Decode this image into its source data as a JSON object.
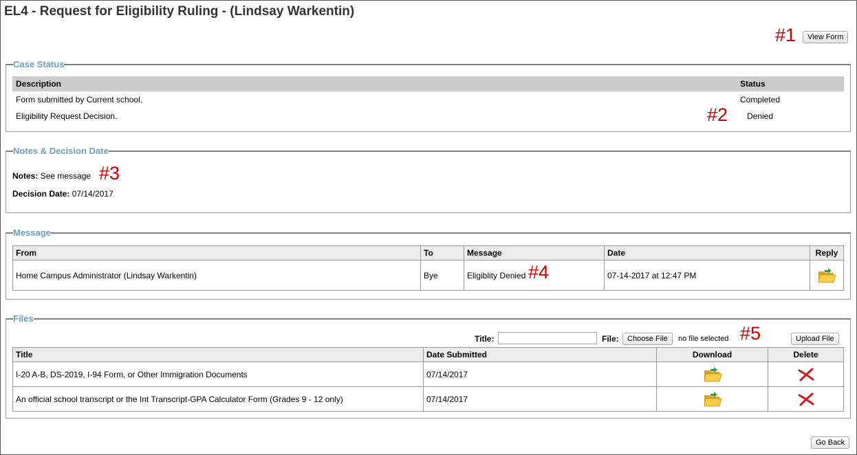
{
  "page": {
    "title": "EL4 - Request for Eligibility Ruling - (Lindsay Warkentin)"
  },
  "toolbar": {
    "view_form_label": "View Form",
    "go_back_label": "Go Back"
  },
  "annotations": [
    "#1",
    "#2",
    "#3",
    "#4",
    "#5"
  ],
  "case_status": {
    "legend": "Case Status",
    "headers": {
      "description": "Description",
      "status": "Status"
    },
    "rows": [
      {
        "description": "Form submitted by Current school.",
        "status": "Completed"
      },
      {
        "description": "Eligibility Request Decision.",
        "status": "Denied"
      }
    ]
  },
  "notes": {
    "legend": "Notes & Decision Date",
    "notes_label": "Notes:",
    "notes_value": "See message",
    "decision_label": "Decision Date:",
    "decision_value": "07/14/2017"
  },
  "message": {
    "legend": "Message",
    "headers": {
      "from": "From",
      "to": "To",
      "message": "Message",
      "date": "Date",
      "reply": "Reply"
    },
    "rows": [
      {
        "from": "Home Campus Administrator (Lindsay Warkentin)",
        "to": "Bye",
        "message": "Eligiblity Denied",
        "date": "07-14-2017 at 12:47 PM",
        "reply_icon": "folder-icon"
      }
    ]
  },
  "files": {
    "legend": "Files",
    "title_label": "Title:",
    "title_value": "",
    "file_label": "File:",
    "choose_file_label": "Choose File",
    "no_file_text": "no file selected",
    "upload_label": "Upload File",
    "headers": {
      "title": "Title",
      "date": "Date Submitted",
      "download": "Download",
      "delete": "Delete"
    },
    "rows": [
      {
        "title": "I-20 A-B, DS-2019, I-94 Form, or Other Immigration Documents",
        "date": "07/14/2017",
        "download_icon": "folder-icon",
        "delete_icon": "red-x-icon"
      },
      {
        "title": "An official school transcript or the Int Transcript-GPA Calculator Form (Grades 9 - 12 only)",
        "date": "07/14/2017",
        "download_icon": "folder-icon",
        "delete_icon": "red-x-icon"
      }
    ]
  },
  "colors": {
    "legend": "#6b9ec7",
    "annotation": "#cc0000",
    "header_bg": "#cccccc"
  }
}
